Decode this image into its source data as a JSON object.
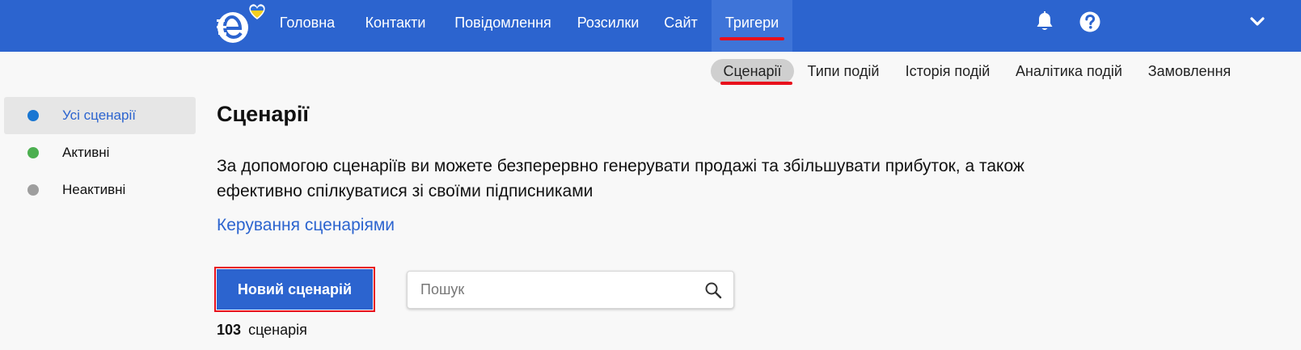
{
  "colors": {
    "brand_blue": "#2c64cf",
    "highlight_red": "#e8101c",
    "status_all": "#1976d2",
    "status_active": "#4caf50",
    "status_inactive": "#9e9e9e"
  },
  "header": {
    "logo_icon": "esputnik-logo-with-ukraine-heart",
    "nav": [
      {
        "label": "Головна"
      },
      {
        "label": "Контакти"
      },
      {
        "label": "Повідомлення"
      },
      {
        "label": "Розсилки"
      },
      {
        "label": "Сайт"
      },
      {
        "label": "Тригери",
        "active": true
      }
    ],
    "icons": [
      "bell-icon",
      "help-icon",
      "chevron-down-icon"
    ]
  },
  "subnav": [
    {
      "label": "Сценарії",
      "active": true
    },
    {
      "label": "Типи подій"
    },
    {
      "label": "Історія подій"
    },
    {
      "label": "Аналітика подій"
    },
    {
      "label": "Замовлення"
    }
  ],
  "sidebar": {
    "items": [
      {
        "label": "Усі сценарії",
        "active": true,
        "status": "all"
      },
      {
        "label": "Активні",
        "status": "active"
      },
      {
        "label": "Неактивні",
        "status": "inactive"
      }
    ]
  },
  "main": {
    "title": "Сценарії",
    "description_line1": "За допомогою сценаріїв ви можете безперервно генерувати продажі та збільшувати прибуток, а також",
    "description_line2": "ефективно спілкуватися зі своїми підписниками",
    "manage_link": "Керування сценаріями",
    "new_button": "Новий сценарій",
    "search": {
      "placeholder": "Пошук",
      "value": ""
    },
    "count": {
      "number": "103",
      "label": "сценарія"
    }
  }
}
